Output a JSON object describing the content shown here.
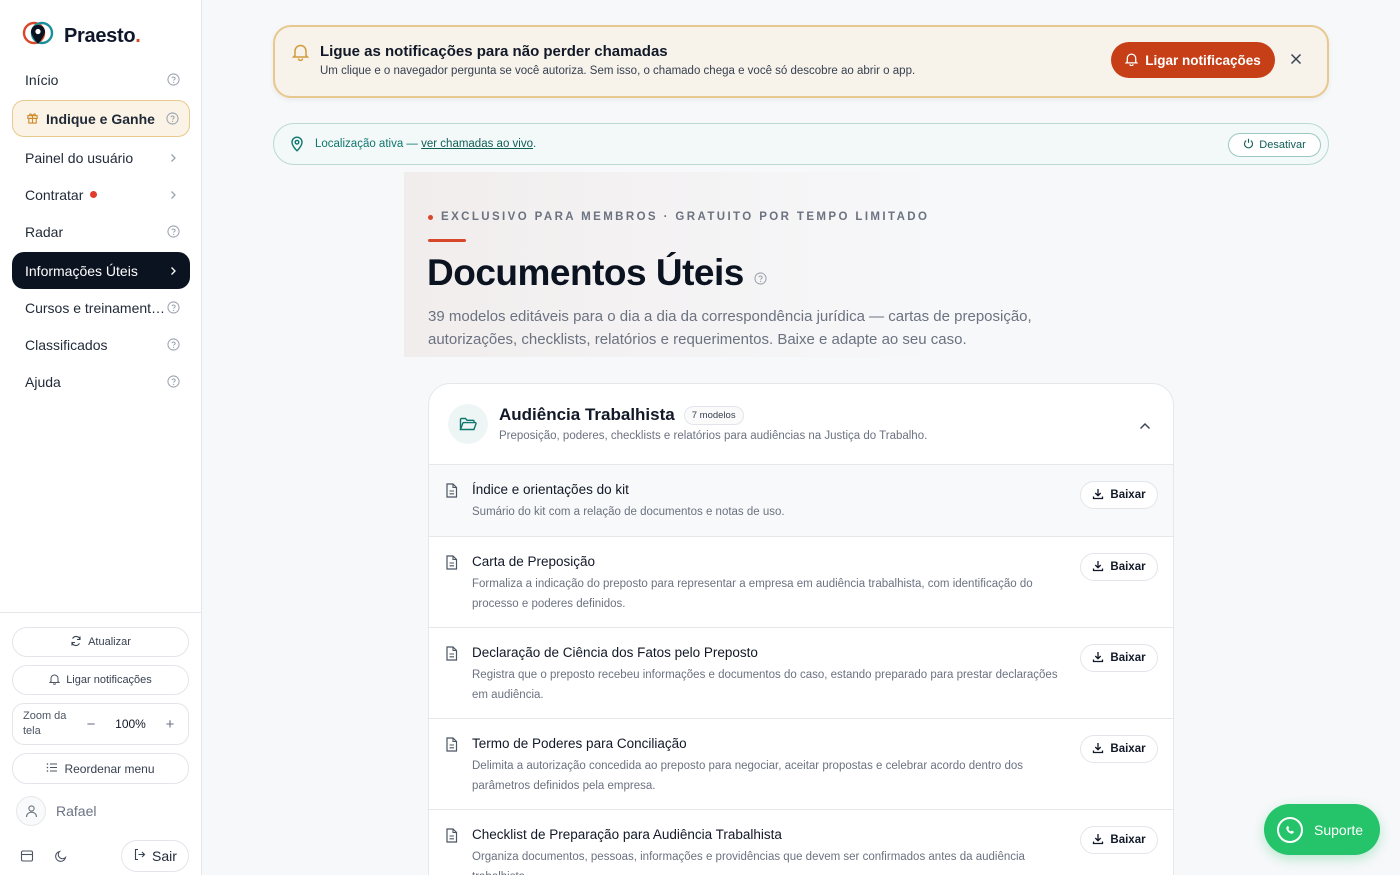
{
  "brand": {
    "name": "Praesto",
    "dot": "."
  },
  "sidebar": {
    "items": [
      {
        "label": "Início",
        "trail": "help"
      },
      {
        "label": "Indique e Ganhe",
        "trail": "help"
      },
      {
        "label": "Painel do usuário",
        "trail": "chevron"
      },
      {
        "label": "Contratar",
        "trail": "chevron"
      },
      {
        "label": "Radar",
        "trail": "help"
      },
      {
        "label": "Informações Úteis",
        "trail": "chevron"
      },
      {
        "label": "Cursos e treinament…",
        "trail": "help"
      },
      {
        "label": "Classificados",
        "trail": "help"
      },
      {
        "label": "Ajuda",
        "trail": "help"
      }
    ],
    "refresh_label": "Atualizar",
    "notify_label": "Ligar notificações",
    "zoom_label": "Zoom da tela",
    "zoom_value": "100%",
    "reorder_label": "Reordenar menu",
    "user_name": "Rafael",
    "logout_label": "Sair"
  },
  "notification": {
    "title": "Ligue as notificações para não perder chamadas",
    "subtitle": "Um clique e o navegador pergunta se você autoriza. Sem isso, o chamado chega e você só descobre ao abrir o app.",
    "cta": "Ligar notificações"
  },
  "location": {
    "prefix": "Localização ativa — ",
    "link": "ver chamadas ao vivo",
    "suffix": ".",
    "disable": "Desativar"
  },
  "hero": {
    "kicker": "EXCLUSIVO PARA MEMBROS · GRATUITO POR TEMPO LIMITADO",
    "title": "Documentos Úteis",
    "lead": "39 modelos editáveis para o dia a dia da correspondência jurídica — cartas de preposição, autorizações, checklists, relatórios e requerimentos. Baixe e adapte ao seu caso."
  },
  "category": {
    "title": "Audiência Trabalhista",
    "badge": "7 modelos",
    "subtitle": "Preposição, poderes, checklists e relatórios para audiências na Justiça do Trabalho.",
    "download_label": "Baixar",
    "docs": [
      {
        "title": "Índice e orientações do kit",
        "desc": "Sumário do kit com a relação de documentos e notas de uso."
      },
      {
        "title": "Carta de Preposição",
        "desc": "Formaliza a indicação do preposto para representar a empresa em audiência trabalhista, com identificação do processo e poderes definidos."
      },
      {
        "title": "Declaração de Ciência dos Fatos pelo Preposto",
        "desc": "Registra que o preposto recebeu informações e documentos do caso, estando preparado para prestar declarações em audiência."
      },
      {
        "title": "Termo de Poderes para Conciliação",
        "desc": "Delimita a autorização concedida ao preposto para negociar, aceitar propostas e celebrar acordo dentro dos parâmetros definidos pela empresa."
      },
      {
        "title": "Checklist de Preparação para Audiência Trabalhista",
        "desc": "Organiza documentos, pessoas, informações e providências que devem ser confirmados antes da audiência trabalhista."
      }
    ]
  },
  "support": {
    "label": "Suporte"
  },
  "colors": {
    "accent": "#d9472b",
    "cta": "#c63f16",
    "active_nav": "#0b1220",
    "teal": "#0f766e",
    "whatsapp": "#25c36a"
  }
}
